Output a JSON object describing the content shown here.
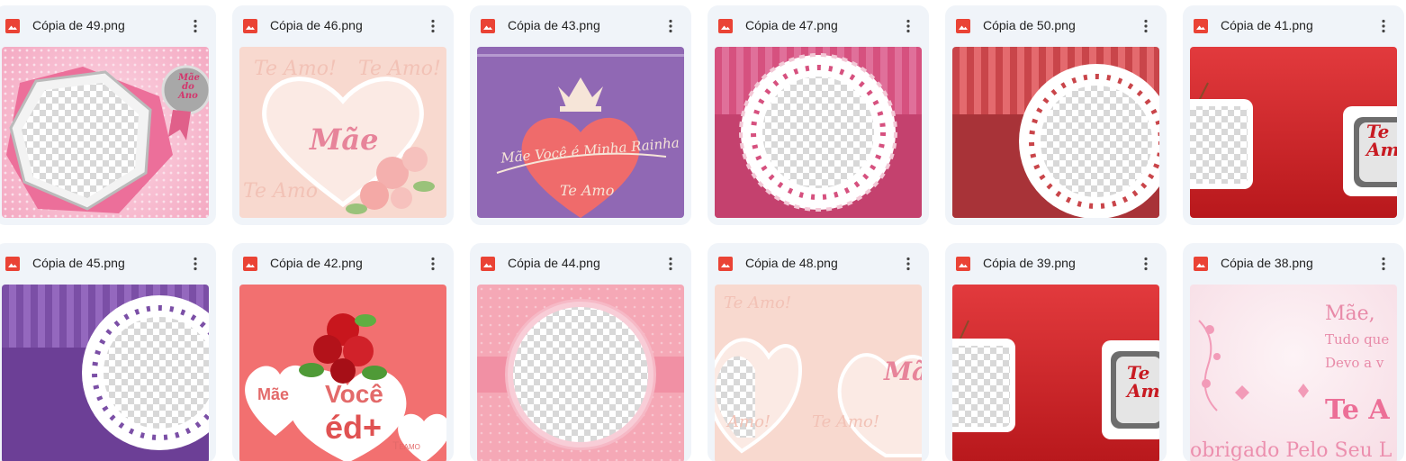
{
  "files": [
    {
      "name": "Cópia de 49.png",
      "badge": [
        "Mãe",
        "do",
        "Ano"
      ]
    },
    {
      "name": "Cópia de 46.png",
      "overlay": [
        "Te Amo!",
        "Te Amo!",
        "Mãe",
        "Te Amo"
      ]
    },
    {
      "name": "Cópia de 43.png",
      "overlay": [
        "Mãe Você é Minha Rainha",
        "Te Amo"
      ]
    },
    {
      "name": "Cópia de 47.png"
    },
    {
      "name": "Cópia de 50.png"
    },
    {
      "name": "Cópia de 41.png",
      "overlay": [
        "Te",
        "Amo"
      ]
    },
    {
      "name": "Cópia de 45.png"
    },
    {
      "name": "Cópia de 42.png",
      "overlay": [
        "Mãe",
        "Você",
        "éd+",
        "Teamo"
      ]
    },
    {
      "name": "Cópia de 44.png"
    },
    {
      "name": "Cópia de 48.png",
      "overlay": [
        "Te Amo!",
        "Amo!",
        "Te Amo!",
        "Mã"
      ]
    },
    {
      "name": "Cópia de 39.png",
      "overlay": [
        "Te",
        "Amo"
      ]
    },
    {
      "name": "Cópia de 38.png",
      "overlay": [
        "Mãe,",
        "Tudo que",
        "Devo a v",
        "Te A",
        "obrigado Pelo Seu L"
      ]
    }
  ],
  "icons": {
    "file_type": "image-file-icon",
    "menu": "more-vert-icon"
  },
  "colors": {
    "card_bg": "#f0f4f9",
    "file_icon_red": "#ea4335",
    "text": "#1f1f1f"
  }
}
